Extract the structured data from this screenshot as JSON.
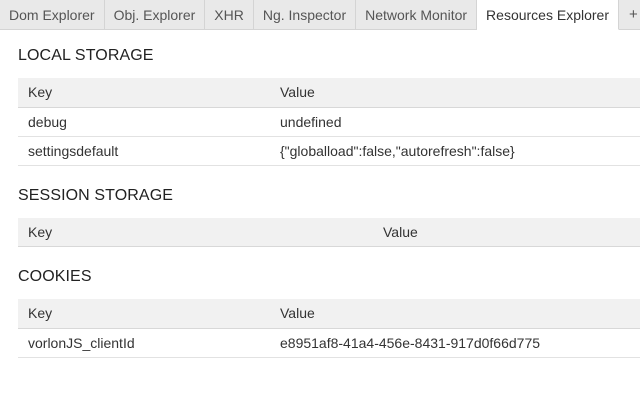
{
  "tabs": [
    {
      "label": "Dom Explorer",
      "active": false
    },
    {
      "label": "Obj. Explorer",
      "active": false
    },
    {
      "label": "XHR",
      "active": false
    },
    {
      "label": "Ng. Inspector",
      "active": false
    },
    {
      "label": "Network Monitor",
      "active": false
    },
    {
      "label": "Resources Explorer",
      "active": true
    }
  ],
  "add_tab_label": "+",
  "local_storage": {
    "title": "LOCAL STORAGE",
    "headers": {
      "key": "Key",
      "value": "Value"
    },
    "rows": [
      {
        "key": "debug",
        "value": "undefined"
      },
      {
        "key": "settingsdefault",
        "value": "{\"globalload\":false,\"autorefresh\":false}"
      }
    ]
  },
  "session_storage": {
    "title": "SESSION STORAGE",
    "headers": {
      "key": "Key",
      "value": "Value"
    },
    "rows": []
  },
  "cookies": {
    "title": "COOKIES",
    "headers": {
      "key": "Key",
      "value": "Value"
    },
    "rows": [
      {
        "key": "vorlonJS_clientId",
        "value": "e8951af8-41a4-456e-8431-917d0f66d775"
      }
    ]
  }
}
